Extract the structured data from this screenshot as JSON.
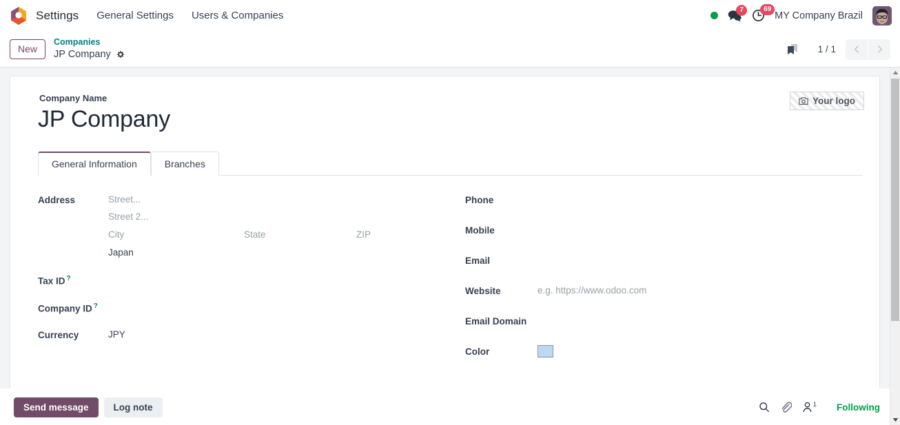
{
  "navbar": {
    "logo_icon": "odoo-logo-icon",
    "app_name": "Settings",
    "menus": [
      {
        "label": "General Settings"
      },
      {
        "label": "Users & Companies"
      }
    ],
    "status_dot_color": "#00a04a",
    "messages_icon": "chat-bubble-icon",
    "messages_badge": "7",
    "activities_icon": "clock-icon",
    "activities_badge": "69",
    "company_selector": "MY Company Brazil",
    "avatar_icon": "user-avatar"
  },
  "control_panel": {
    "new_label": "New",
    "breadcrumb_parent": "Companies",
    "breadcrumb_current": "JP Company",
    "settings_cog_icon": "gear-icon",
    "view_switch_icon": "list-view-icon",
    "pager": "1 / 1",
    "prev_icon": "chevron-left-icon",
    "next_icon": "chevron-right-icon"
  },
  "form": {
    "logo_button": {
      "label": "Your logo",
      "icon": "camera-icon"
    },
    "name_label": "Company Name",
    "name_value": "JP Company",
    "tabs": [
      {
        "label": "General Information",
        "active": true
      },
      {
        "label": "Branches",
        "active": false
      }
    ],
    "left": {
      "address_label": "Address",
      "address": {
        "street_placeholder": "Street...",
        "street2_placeholder": "Street 2...",
        "city_placeholder": "City",
        "state_placeholder": "State",
        "zip_placeholder": "ZIP",
        "country_value": "Japan"
      },
      "tax_id_label": "Tax ID",
      "tax_id_value": "",
      "tax_id_help": "?",
      "company_id_label": "Company ID",
      "company_id_value": "",
      "company_id_help": "?",
      "currency_label": "Currency",
      "currency_value": "JPY"
    },
    "right": {
      "phone_label": "Phone",
      "phone_value": "",
      "mobile_label": "Mobile",
      "mobile_value": "",
      "email_label": "Email",
      "email_value": "",
      "website_label": "Website",
      "website_placeholder": "e.g. https://www.odoo.com",
      "email_domain_label": "Email Domain",
      "email_domain_value": "",
      "color_label": "Color",
      "color_value": "#bcd9f4"
    }
  },
  "chatter": {
    "send_message_label": "Send message",
    "log_note_label": "Log note",
    "search_icon": "search-icon",
    "attachment_icon": "paperclip-icon",
    "followers_icon": "user-follower-icon",
    "followers_count": "1",
    "following_label": "Following"
  }
}
